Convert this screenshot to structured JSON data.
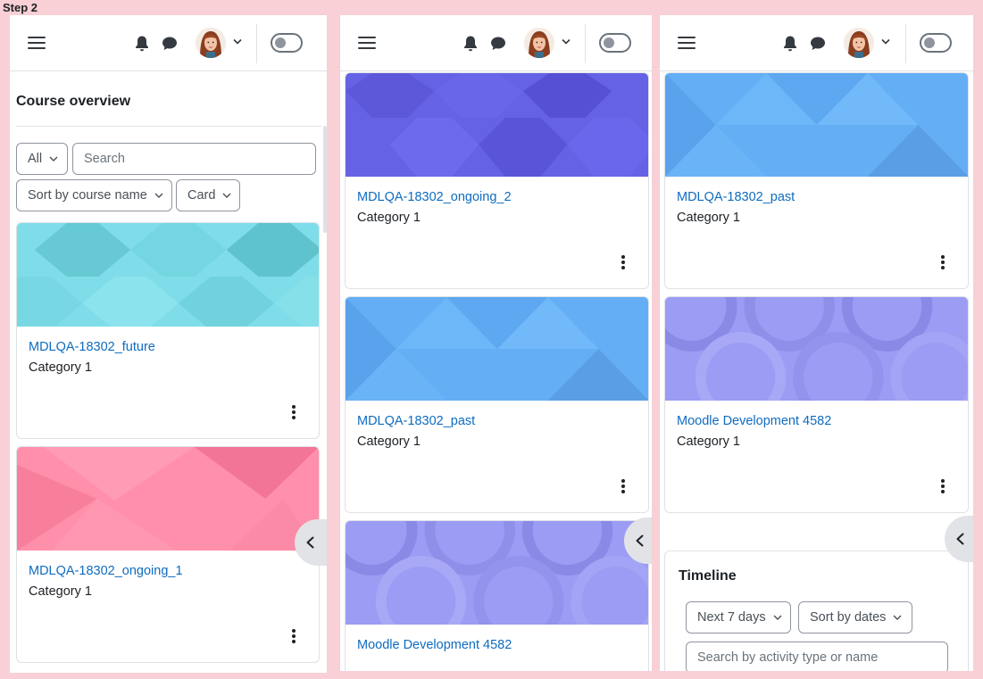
{
  "step_label": "Step 2",
  "colors": {
    "link": "#0f6cbf",
    "text": "#1d2125",
    "teal": "#7fdde9",
    "pink": "#ff8fab",
    "blue": "#64aef5",
    "indigo": "#6662e6",
    "lavender": "#9c9cf4"
  },
  "icons": {
    "menu": "hamburger-menu-icon",
    "bell": "bell-icon",
    "chat": "chat-bubble-icon",
    "caret": "chevron-down-icon",
    "kebab": "kebab-menu-icon",
    "drawer": "chevron-left-icon"
  },
  "panel1": {
    "section_title": "Course overview",
    "filter": {
      "label": "All"
    },
    "search": {
      "placeholder": "Search"
    },
    "sort": {
      "label": "Sort by course name"
    },
    "view": {
      "label": "Card"
    },
    "cards": [
      {
        "title": "MDLQA-18302_future",
        "category": "Category 1"
      },
      {
        "title": "MDLQA-18302_ongoing_1",
        "category": "Category 1"
      }
    ]
  },
  "panel2": {
    "cards": [
      {
        "title": "MDLQA-18302_ongoing_2",
        "category": "Category 1"
      },
      {
        "title": "MDLQA-18302_past",
        "category": "Category 1"
      },
      {
        "title": "Moodle Development 4582"
      }
    ]
  },
  "panel3": {
    "cards": [
      {
        "title": "MDLQA-18302_past",
        "category": "Category 1"
      },
      {
        "title": "Moodle Development 4582",
        "category": "Category 1"
      }
    ],
    "timeline": {
      "title": "Timeline",
      "range": {
        "label": "Next 7 days"
      },
      "sort": {
        "label": "Sort by dates"
      },
      "search": {
        "placeholder": "Search by activity type or name"
      }
    }
  }
}
